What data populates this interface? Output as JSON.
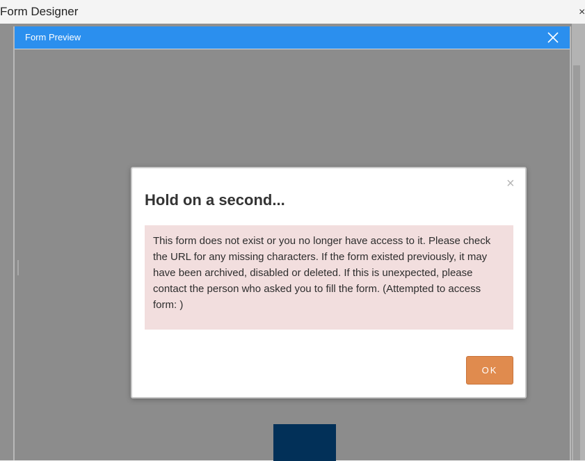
{
  "designer": {
    "title": "Form Designer",
    "close_glyph": "×"
  },
  "preview": {
    "title": "Form Preview",
    "titlebar_color": "#2b8fee"
  },
  "modal": {
    "close_glyph": "×",
    "title": "Hold on a second...",
    "message": "This form does not exist or you no longer have access to it. Please check the URL for any missing characters. If the form existed previously, it may have been archived, disabled or deleted. If this is unexpected, please contact the person who asked you to fill the form. (Attempted to access form: )",
    "ok_label": "OK",
    "ok_color": "#e08b4e",
    "alert_bg": "#f2dede"
  }
}
